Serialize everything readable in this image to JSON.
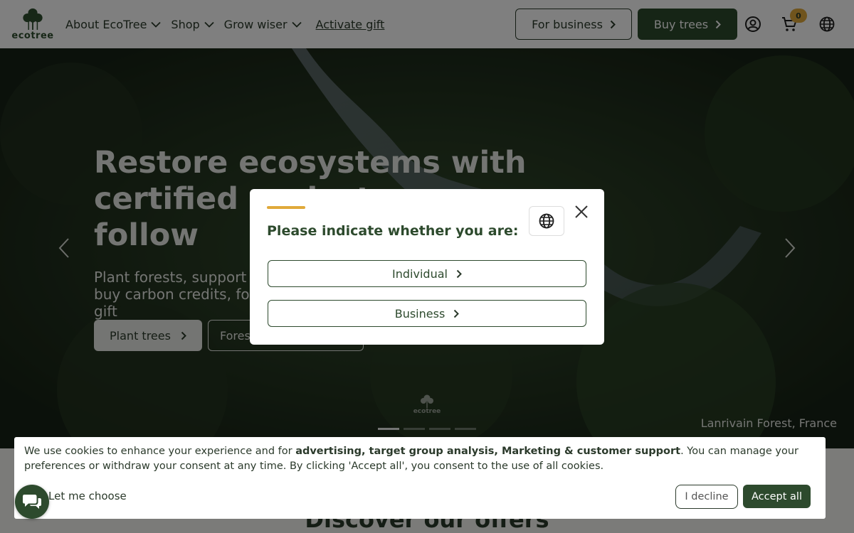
{
  "header": {
    "logo_text": "ecotree",
    "nav": [
      {
        "label": "About EcoTree",
        "has_dropdown": true
      },
      {
        "label": "Shop",
        "has_dropdown": true
      },
      {
        "label": "Grow wiser",
        "has_dropdown": true
      }
    ],
    "activate_gift": "Activate gift",
    "for_business": "For business",
    "buy_trees": "Buy trees",
    "cart_count": "0",
    "icons": [
      "account-icon",
      "cart-icon",
      "globe-icon"
    ]
  },
  "hero": {
    "title": "Restore ecosystems with certified projects you can follow",
    "subtitle": "Plant forests, support biodiversity and buy carbon credits, for yourself or as a gift",
    "primary_cta": "Plant trees",
    "secondary_cta": "Forest projects",
    "watermark": "ecotree",
    "caption": "Lanrivain Forest, France",
    "slides": 4,
    "active_slide": 1
  },
  "section": {
    "heading": "Discover our offers"
  },
  "modal": {
    "title": "Please indicate whether you are:",
    "options": [
      "Individual",
      "Business"
    ]
  },
  "cookie": {
    "text_before": "We use cookies to enhance your experience and for ",
    "text_bold": "advertising, target group analysis, Marketing & customer support",
    "text_after": ". You can manage your preferences or withdraw your consent at any time. By clicking 'Accept all', you consent to the use of all cookies.",
    "let_me_choose": "Let me choose",
    "decline": "I decline",
    "accept": "Accept all"
  },
  "colors": {
    "brand_green": "#2d4a2d",
    "accent_gold": "#e0a93a"
  }
}
